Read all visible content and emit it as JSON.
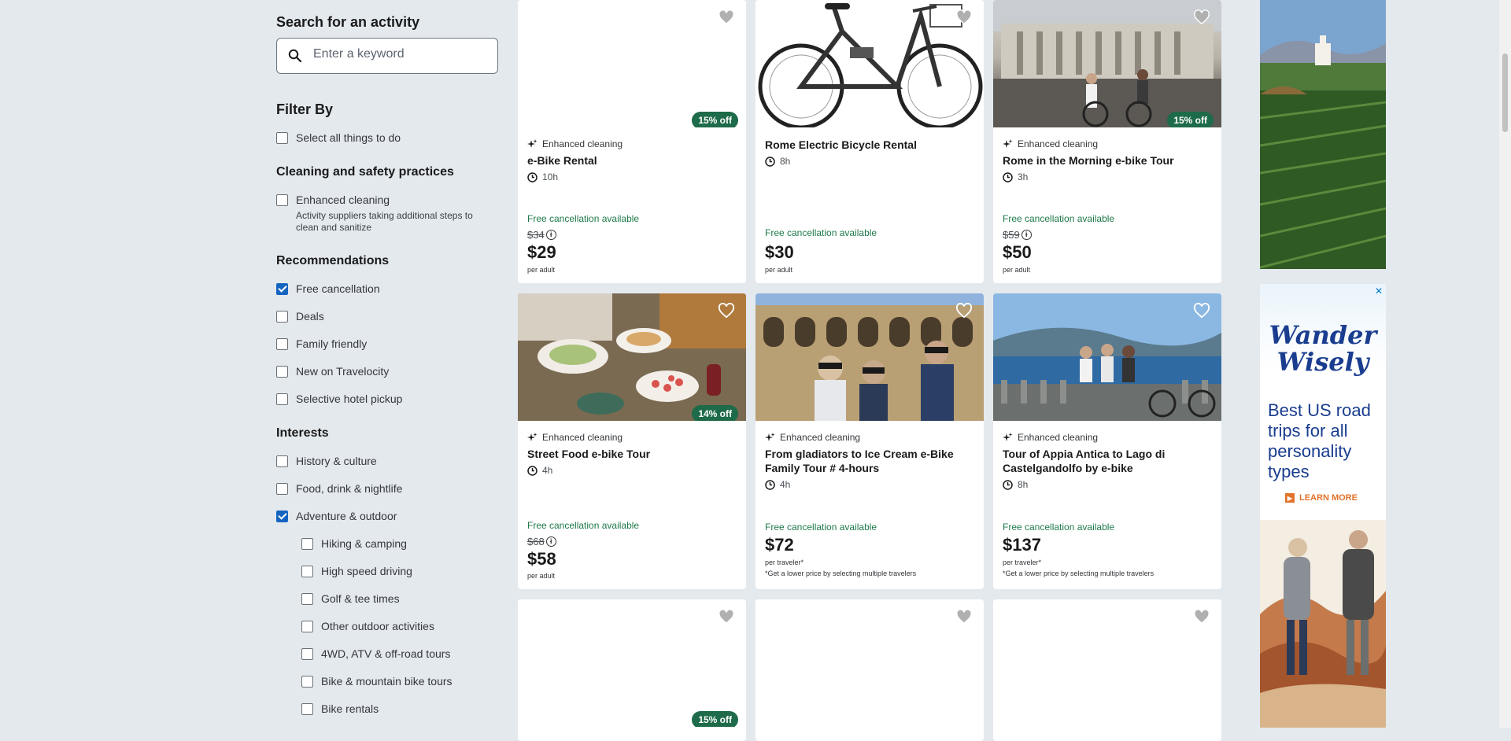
{
  "search": {
    "title": "Search for an activity",
    "placeholder": "Enter a keyword"
  },
  "filter": {
    "title": "Filter By",
    "select_all": {
      "label": "Select all things to do",
      "checked": false
    },
    "cleaning": {
      "title": "Cleaning and safety practices",
      "item": {
        "label": "Enhanced cleaning",
        "checked": false
      },
      "note": "Activity suppliers taking additional steps to clean and sanitize"
    },
    "recommendations": {
      "title": "Recommendations",
      "items": [
        {
          "label": "Free cancellation",
          "checked": true
        },
        {
          "label": "Deals",
          "checked": false
        },
        {
          "label": "Family friendly",
          "checked": false
        },
        {
          "label": "New on Travelocity",
          "checked": false
        },
        {
          "label": "Selective hotel pickup",
          "checked": false
        }
      ]
    },
    "interests": {
      "title": "Interests",
      "items": [
        {
          "label": "History & culture",
          "checked": false
        },
        {
          "label": "Food, drink & nightlife",
          "checked": false
        },
        {
          "label": "Adventure & outdoor",
          "checked": true
        }
      ],
      "sub_items": [
        {
          "label": "Hiking & camping",
          "checked": false
        },
        {
          "label": "High speed driving",
          "checked": false
        },
        {
          "label": "Golf & tee times",
          "checked": false
        },
        {
          "label": "Other outdoor activities",
          "checked": false
        },
        {
          "label": "4WD, ATV & off-road tours",
          "checked": false
        },
        {
          "label": "Bike & mountain bike tours",
          "checked": false
        },
        {
          "label": "Bike rentals",
          "checked": false
        }
      ]
    }
  },
  "cards": [
    {
      "badge": "15% off",
      "cleaning": "Enhanced cleaning",
      "title": "e-Bike Rental",
      "duration": "10h",
      "cancel": "Free cancellation available",
      "was": "$34",
      "price": "$29",
      "per": "per adult",
      "note": ""
    },
    {
      "badge": "",
      "cleaning": "",
      "title": "Rome Electric Bicycle Rental",
      "duration": "8h",
      "cancel": "Free cancellation available",
      "was": "",
      "price": "$30",
      "per": "per adult",
      "note": ""
    },
    {
      "badge": "15% off",
      "cleaning": "Enhanced cleaning",
      "title": "Rome in the Morning e-bike Tour",
      "duration": "3h",
      "cancel": "Free cancellation available",
      "was": "$59",
      "price": "$50",
      "per": "per adult",
      "note": ""
    },
    {
      "badge": "14% off",
      "cleaning": "Enhanced cleaning",
      "title": "Street Food e-bike Tour",
      "duration": "4h",
      "cancel": "Free cancellation available",
      "was": "$68",
      "price": "$58",
      "per": "per adult",
      "note": ""
    },
    {
      "badge": "",
      "cleaning": "Enhanced cleaning",
      "title": "From gladiators to Ice Cream e-Bike Family Tour # 4-hours",
      "duration": "4h",
      "cancel": "Free cancellation available",
      "was": "",
      "price": "$72",
      "per": "per traveler*",
      "note": "*Get a lower price by selecting multiple travelers"
    },
    {
      "badge": "",
      "cleaning": "Enhanced cleaning",
      "title": "Tour of Appia Antica to Lago di Castelgandolfo by e-bike",
      "duration": "8h",
      "cancel": "Free cancellation available",
      "was": "",
      "price": "$137",
      "per": "per traveler*",
      "note": "*Get a lower price by selecting multiple travelers"
    },
    {
      "badge": "15% off"
    }
  ],
  "ad": {
    "brand_line1": "Wander",
    "brand_line2": "Wisely",
    "headline": "Best US road trips for all personality types",
    "cta": "LEARN MORE",
    "close": "✕"
  },
  "colors": {
    "accent": "#1565c0",
    "deal": "#1e6b49",
    "cancel": "#1e7a4a",
    "background": "#e4e9ee"
  }
}
